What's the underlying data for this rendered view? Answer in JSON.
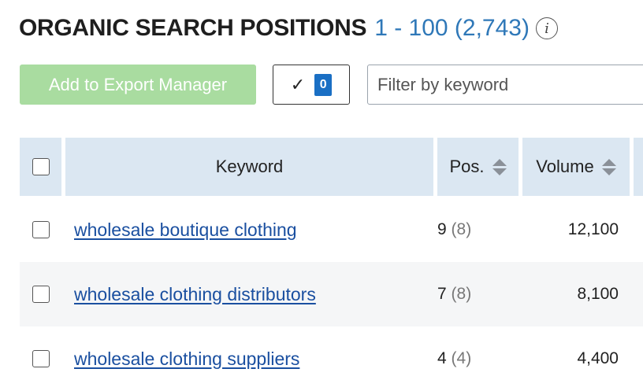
{
  "header": {
    "title": "ORGANIC SEARCH POSITIONS",
    "range": "1 - 100 (2,743)",
    "info_icon": "info-icon"
  },
  "toolbar": {
    "export_label": "Add to Export Manager",
    "selected_count": "0",
    "filter_placeholder": "Filter by keyword"
  },
  "colors": {
    "export_button": "#a9dca0",
    "accent_blue": "#1a6fc4",
    "link": "#1a4fa0",
    "header_bg": "#dbe7f2"
  },
  "table": {
    "columns": {
      "keyword": "Keyword",
      "pos": "Pos.",
      "volume": "Volume"
    },
    "rows": [
      {
        "keyword": "wholesale boutique clothing",
        "pos": "9",
        "prev_pos": "(8)",
        "volume": "12,100"
      },
      {
        "keyword": "wholesale clothing distributors",
        "pos": "7",
        "prev_pos": "(8)",
        "volume": "8,100"
      },
      {
        "keyword": "wholesale clothing suppliers",
        "pos": "4",
        "prev_pos": "(4)",
        "volume": "4,400"
      }
    ]
  }
}
